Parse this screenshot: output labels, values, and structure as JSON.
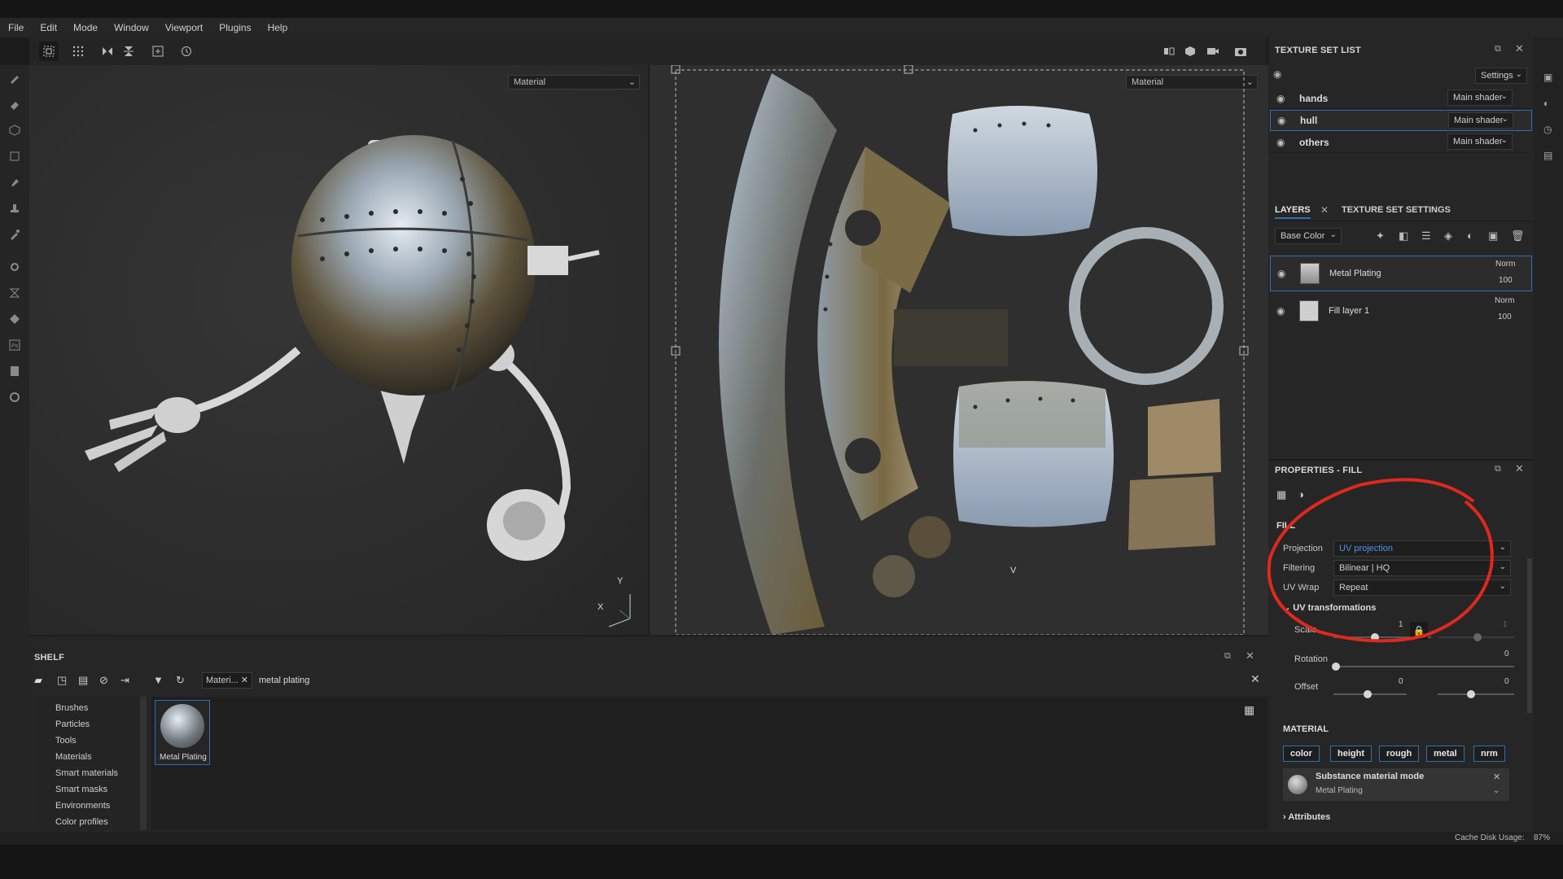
{
  "menu": [
    "File",
    "Edit",
    "Mode",
    "Window",
    "Viewport",
    "Plugins",
    "Help"
  ],
  "viewport": {
    "left_dropdown": "Material",
    "right_dropdown": "Material",
    "axis_y": "Y",
    "axis_x": "X",
    "axis_y2": "V"
  },
  "texture_set_list": {
    "title": "TEXTURE SET LIST",
    "settings_label": "Settings",
    "rows": [
      {
        "name": "hands",
        "shader": "Main shader"
      },
      {
        "name": "hull",
        "shader": "Main shader"
      },
      {
        "name": "others",
        "shader": "Main shader"
      }
    ]
  },
  "layers": {
    "tab_layers": "LAYERS",
    "tab_texture_set_settings": "TEXTURE SET SETTINGS",
    "channel_select": "Base Color",
    "items": [
      {
        "name": "Metal Plating",
        "blend": "Norm",
        "opacity": "100"
      },
      {
        "name": "Fill layer 1",
        "blend": "Norm",
        "opacity": "100"
      }
    ]
  },
  "properties": {
    "title": "PROPERTIES - FILL",
    "fill_header": "FILL",
    "projection_label": "Projection",
    "projection_value": "UV projection",
    "filtering_label": "Filtering",
    "filtering_value": "Bilinear | HQ",
    "uvwrap_label": "UV Wrap",
    "uvwrap_value": "Repeat",
    "uv_transform_header": "UV transformations",
    "scale_label": "Scale",
    "scale_value_1": "1",
    "scale_value_2": "1",
    "rotation_label": "Rotation",
    "rotation_value": "0",
    "offset_label": "Offset",
    "offset_value_1": "0",
    "offset_value_2": "0",
    "material_header": "MATERIAL",
    "channels": [
      "color",
      "height",
      "rough",
      "metal",
      "nrm"
    ],
    "substance_mode": "Substance material mode",
    "substance_name": "Metal Plating",
    "attributes": "Attributes"
  },
  "shelf": {
    "title": "SHELF",
    "filter_tag": "Materi...",
    "search_value": "metal plating",
    "categories": [
      "Brushes",
      "Particles",
      "Tools",
      "Materials",
      "Smart materials",
      "Smart masks",
      "Environments",
      "Color profiles"
    ],
    "result_label": "Metal Plating"
  },
  "status": {
    "cache_label": "Cache Disk Usage:",
    "cache_value": "87%"
  },
  "colors": {
    "accent_blue": "#2d6fb4",
    "annotation_red": "#e0281e",
    "panel_bg": "#262626"
  }
}
